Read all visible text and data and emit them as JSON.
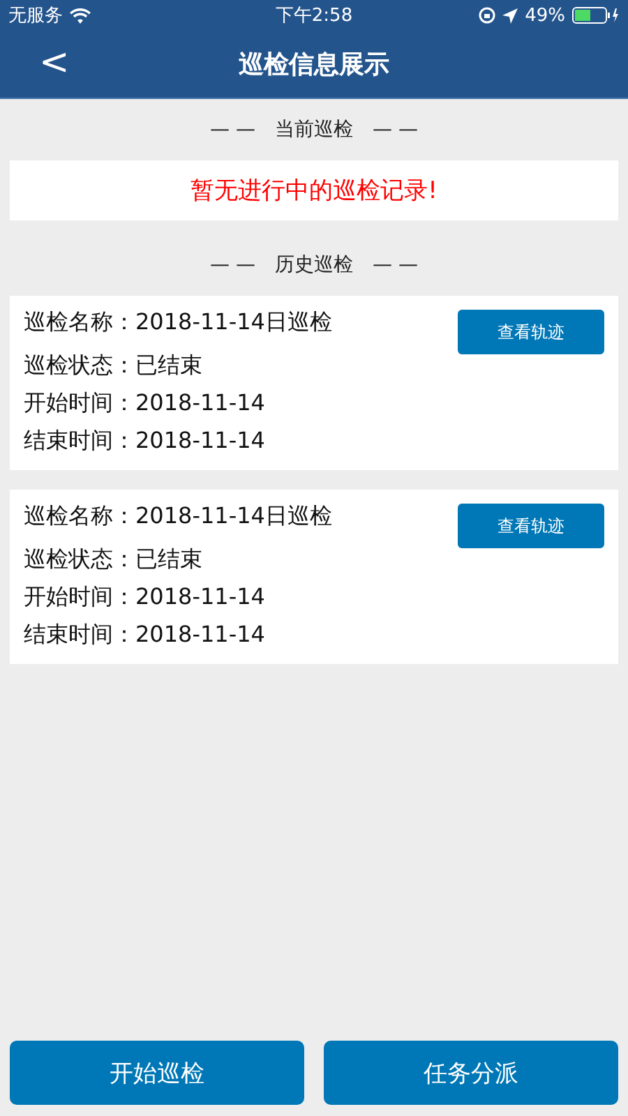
{
  "status_bar": {
    "carrier": "无服务",
    "time": "下午2:58",
    "battery": "49%"
  },
  "nav": {
    "back": "<",
    "title": "巡检信息展示"
  },
  "current_section": {
    "dash_left": "— —",
    "label": "当前巡检",
    "dash_right": "— —",
    "notice": "暂无进行中的巡检记录!"
  },
  "history_section": {
    "dash_left": "— —",
    "label": "历史巡检",
    "dash_right": "— —"
  },
  "records": [
    {
      "fields": [
        {
          "label": "巡检名称：",
          "value": "2018-11-14日巡检"
        },
        {
          "label": "巡检状态：",
          "value": "已结束"
        },
        {
          "label": "开始时间：",
          "value": "2018-11-14"
        },
        {
          "label": "结束时间：",
          "value": "2018-11-14"
        }
      ],
      "button": "查看轨迹"
    },
    {
      "fields": [
        {
          "label": "巡检名称：",
          "value": "2018-11-14日巡检"
        },
        {
          "label": "巡检状态：",
          "value": "已结束"
        },
        {
          "label": "开始时间：",
          "value": "2018-11-14"
        },
        {
          "label": "结束时间：",
          "value": "2018-11-14"
        }
      ],
      "button": "查看轨迹"
    }
  ],
  "bottom_buttons": [
    "开始巡检",
    "任务分派"
  ]
}
